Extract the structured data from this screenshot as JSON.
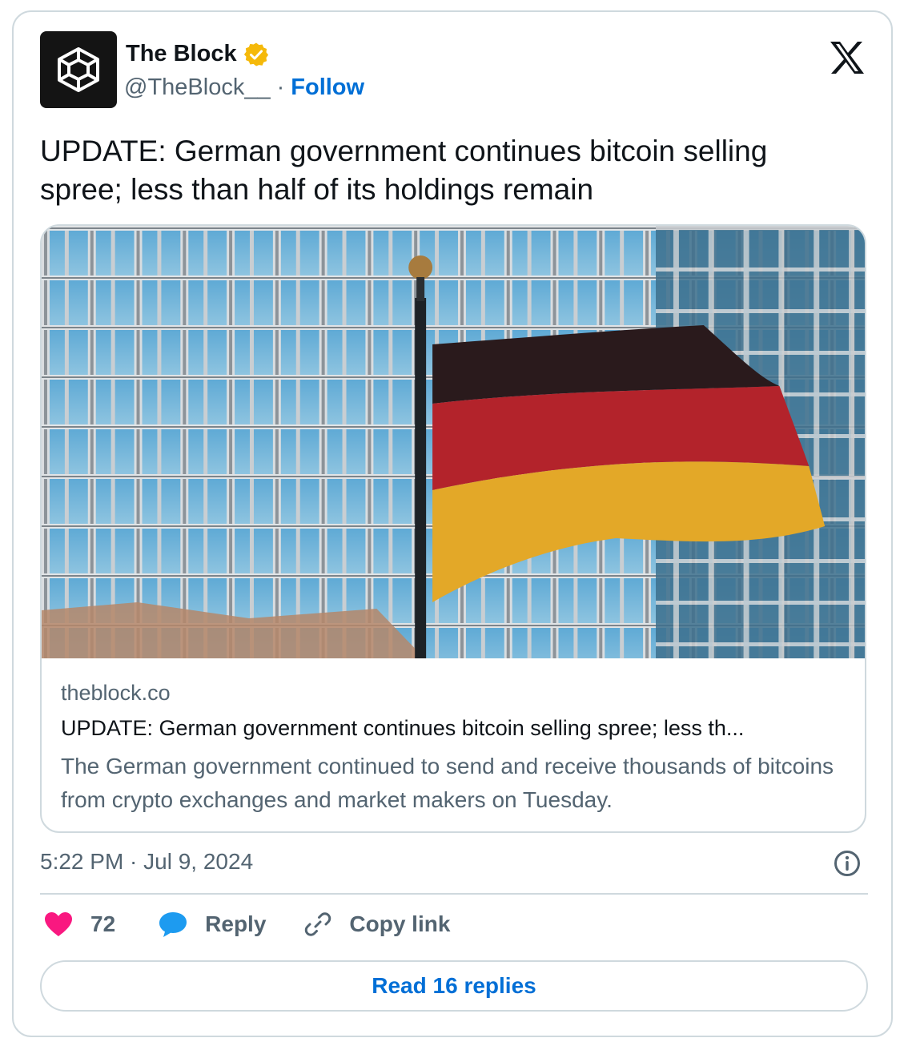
{
  "author": {
    "display_name": "The Block",
    "handle": "@TheBlock__",
    "separator": "·",
    "follow_label": "Follow",
    "verified": true,
    "verified_color": "#f5b90a",
    "avatar_icon": "cube-logo-icon"
  },
  "tweet": {
    "text": "UPDATE: German government continues bitcoin selling spree; less than half of its holdings remain"
  },
  "link_card": {
    "image_icon": "german-flag-photo",
    "domain": "theblock.co",
    "title": "UPDATE: German government continues bitcoin selling spree; less th...",
    "description": "The German government continued to send and receive thousands of bitcoins from crypto exchanges and market makers on Tuesday."
  },
  "meta": {
    "timestamp": "5:22 PM · Jul 9, 2024"
  },
  "actions": {
    "like_count": "72",
    "reply_label": "Reply",
    "copy_link_label": "Copy link",
    "like_color": "#f91880",
    "reply_color": "#1d9bf0"
  },
  "read_replies_label": "Read 16 replies",
  "colors": {
    "link_blue": "#006fd6",
    "secondary_text": "#536471",
    "border": "#cfd9de"
  }
}
